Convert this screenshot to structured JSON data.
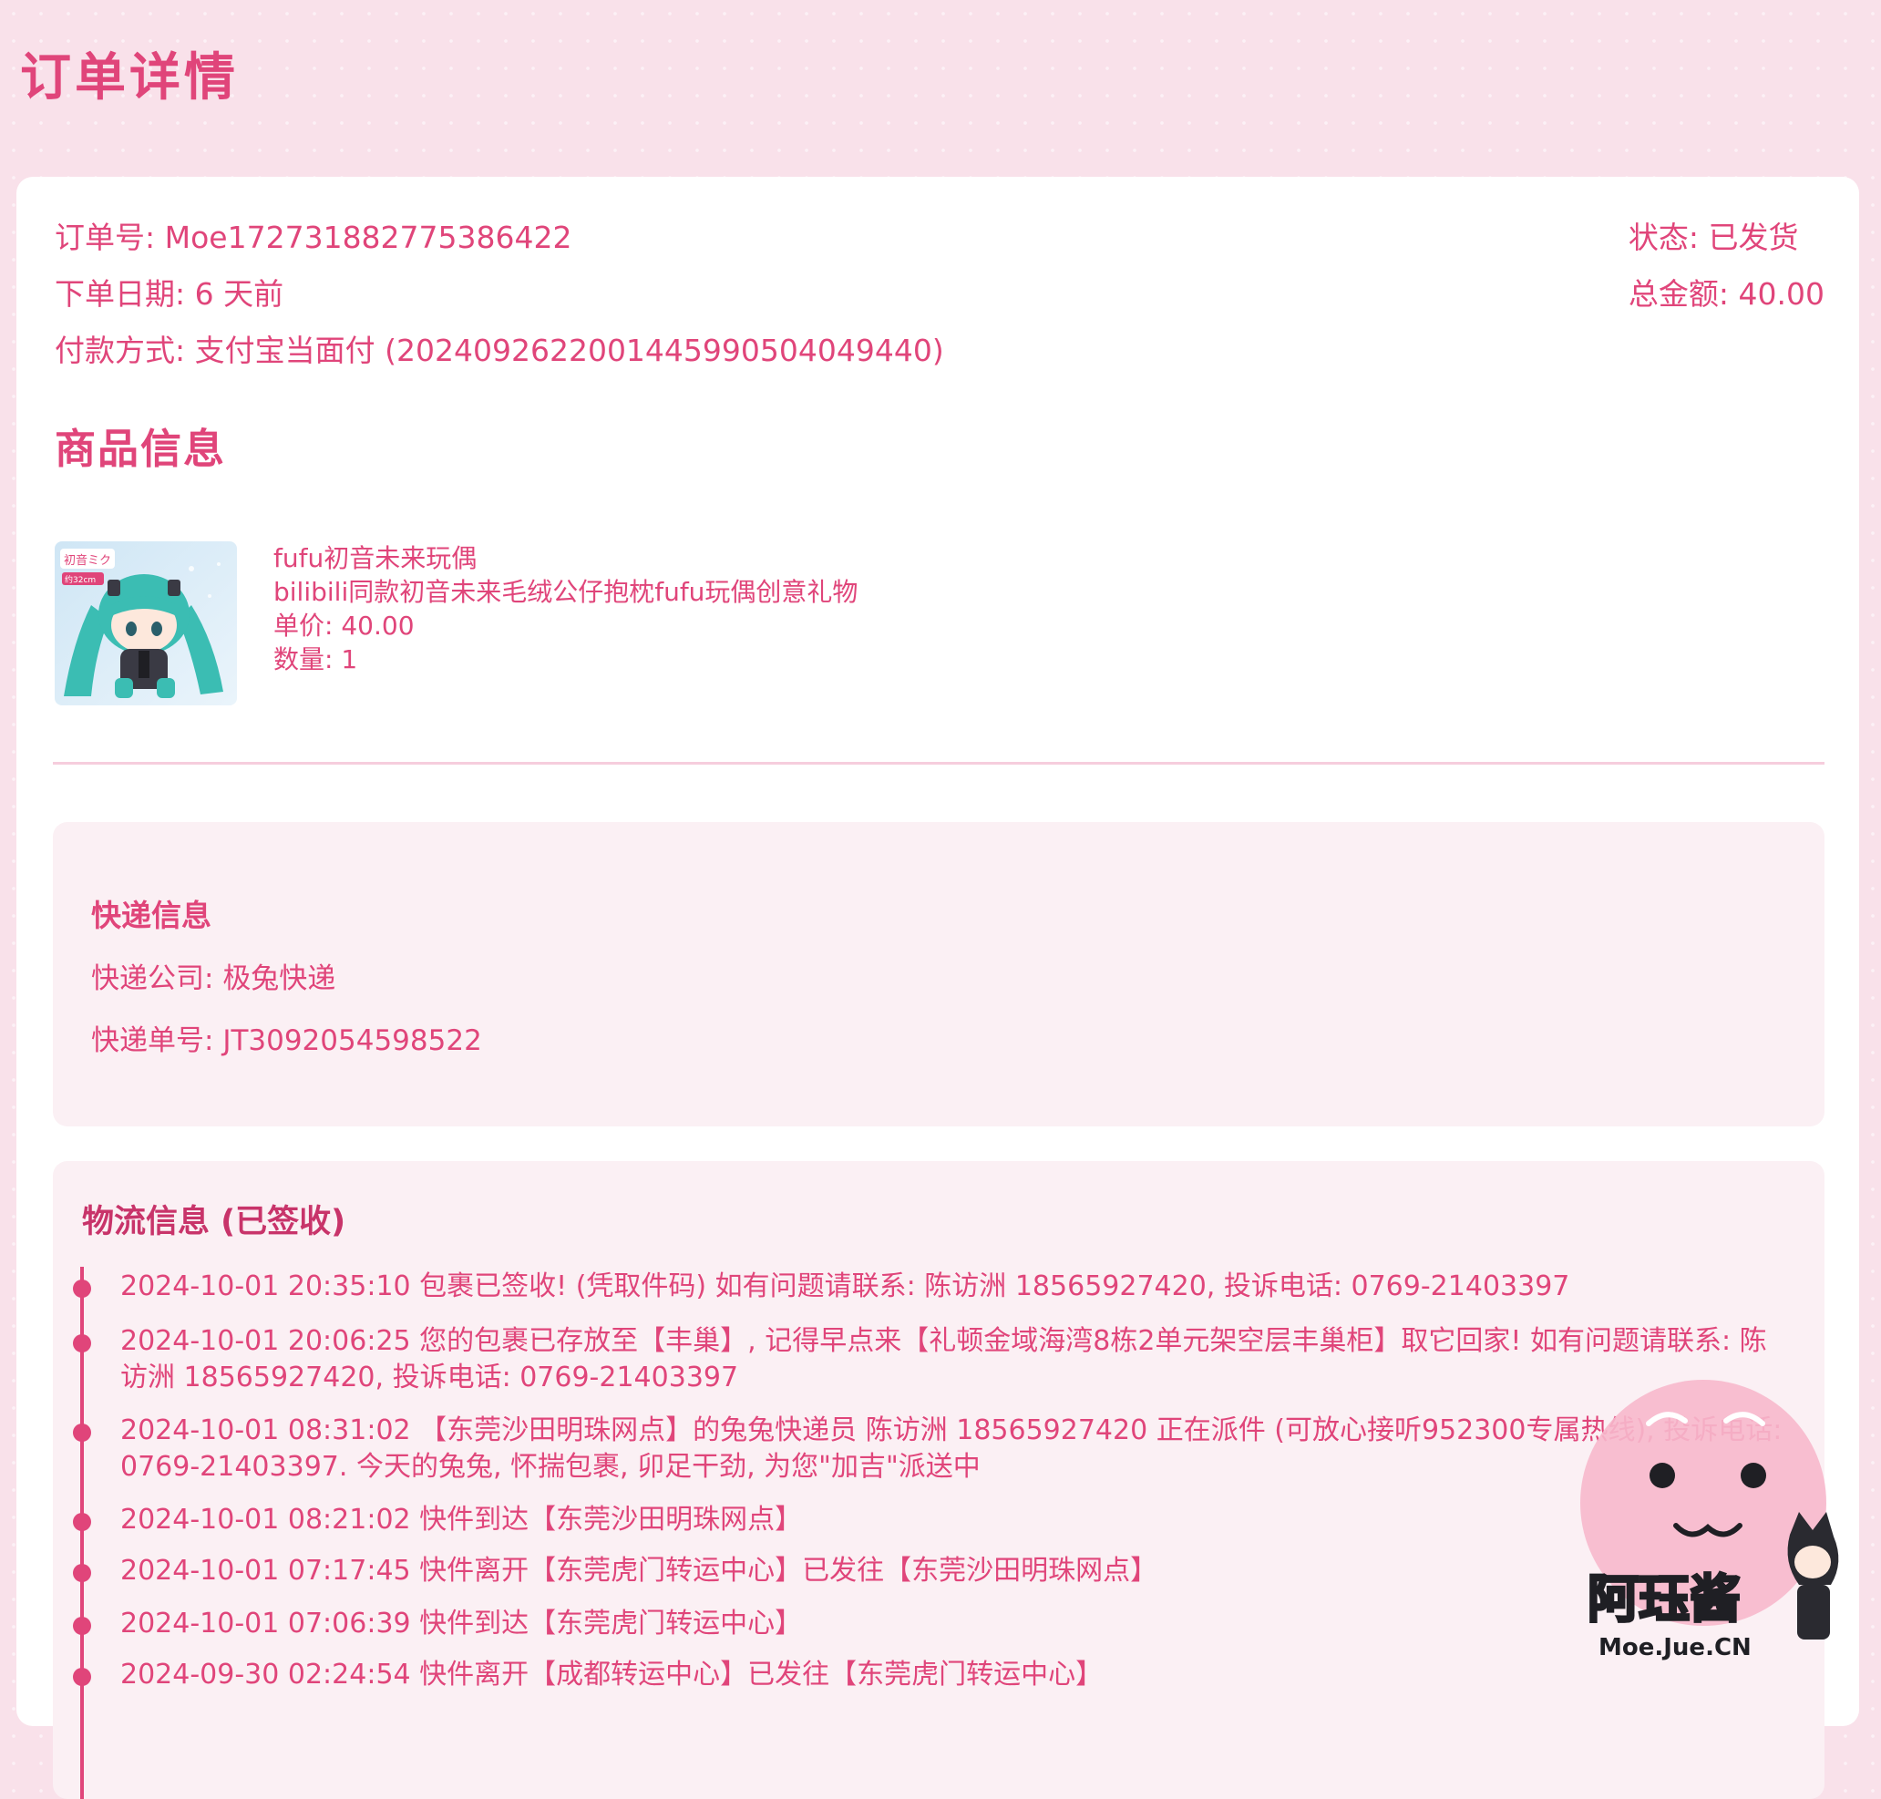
{
  "page": {
    "title": "订单详情"
  },
  "order": {
    "number_label": "订单号:",
    "number": "Moe172731882775386422",
    "date_label": "下单日期:",
    "date": "6 天前",
    "payment_label": "付款方式:",
    "payment": "支付宝当面付 (2024092622001445990504049440)",
    "status_label": "状态:",
    "status": "已发货",
    "total_label": "总金额:",
    "total": "40.00"
  },
  "products_section": {
    "title": "商品信息"
  },
  "product": {
    "name": "fufu初音未来玩偶",
    "description": "bilibili同款初音未来毛绒公仔抱枕fufu玩偶创意礼物",
    "unit_price_label": "单价:",
    "unit_price": "40.00",
    "quantity_label": "数量:",
    "quantity": "1",
    "thumb_text": "初音ミク",
    "thumb_size": "约32cm"
  },
  "express": {
    "title": "快递信息",
    "company_label": "快递公司:",
    "company": "极兔快递",
    "tracking_label": "快递单号:",
    "tracking": "JT3092054598522"
  },
  "logistics": {
    "title": "物流信息 (已签收)",
    "events": [
      {
        "text": "2024-10-01 20:35:10  包裹已签收! (凭取件码) 如有问题请联系: 陈访洲 18565927420, 投诉电话: 0769-21403397"
      },
      {
        "text": "2024-10-01 20:06:25  您的包裹已存放至【丰巢】, 记得早点来【礼顿金域海湾8栋2单元架空层丰巢柜】取它回家! 如有问题请联系: 陈访洲 18565927420, 投诉电话: 0769-21403397"
      },
      {
        "text": "2024-10-01 08:31:02  【东莞沙田明珠网点】的兔兔快递员 陈访洲 18565927420 正在派件 (可放心接听952300专属热线), 投诉电话: 0769-21403397. 今天的兔兔, 怀揣包裹, 卯足干劲, 为您\"加吉\"派送中"
      },
      {
        "text": "2024-10-01 08:21:02  快件到达【东莞沙田明珠网点】"
      },
      {
        "text": "2024-10-01 07:17:45  快件离开【东莞虎门转运中心】已发往【东莞沙田明珠网点】"
      },
      {
        "text": "2024-10-01 07:06:39  快件到达【东莞虎门转运中心】"
      },
      {
        "text": "2024-09-30 02:24:54  快件离开【成都转运中心】已发往【东莞虎门转运中心】"
      }
    ]
  },
  "watermark": {
    "name": "阿珏酱",
    "site": "Moe.Jue.CN"
  },
  "colors": {
    "accent": "#e0457a",
    "background": "#f9e1ea",
    "panel": "#fbf0f4"
  }
}
